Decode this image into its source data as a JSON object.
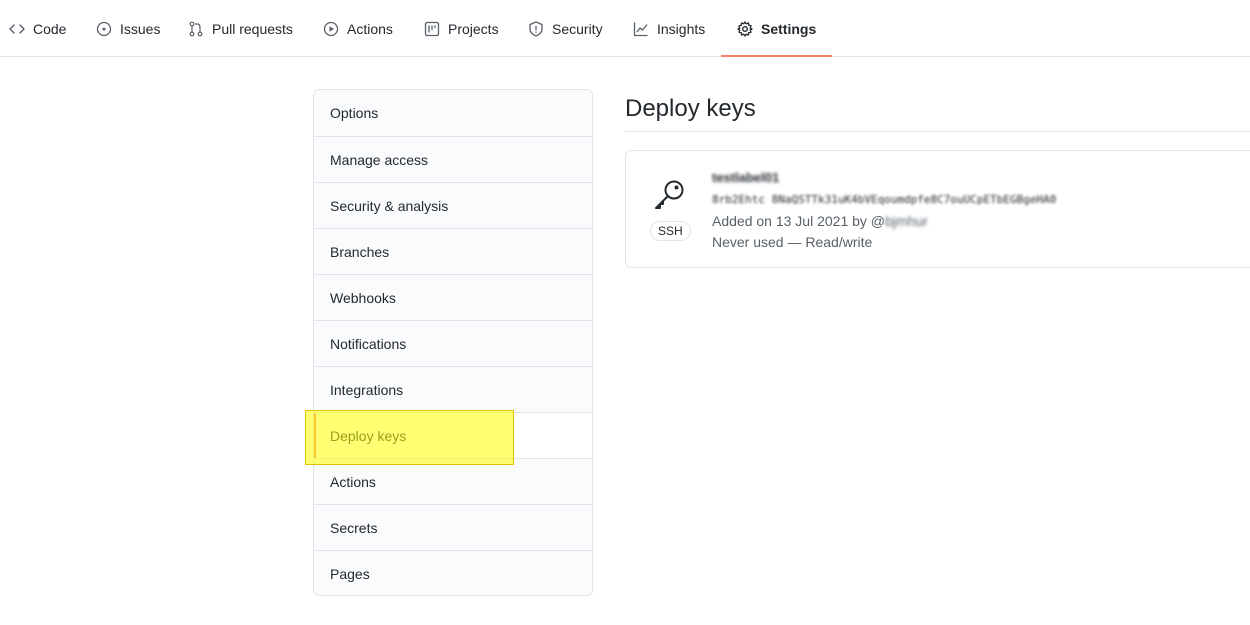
{
  "repo_nav": {
    "tabs": [
      {
        "label": "Code",
        "icon": "code-icon"
      },
      {
        "label": "Issues",
        "icon": "issue-opened-icon"
      },
      {
        "label": "Pull requests",
        "icon": "git-pull-request-icon"
      },
      {
        "label": "Actions",
        "icon": "play-icon"
      },
      {
        "label": "Projects",
        "icon": "project-icon"
      },
      {
        "label": "Security",
        "icon": "shield-icon"
      },
      {
        "label": "Insights",
        "icon": "graph-icon"
      },
      {
        "label": "Settings",
        "icon": "gear-icon",
        "selected": true
      }
    ]
  },
  "settings_menu": {
    "items": [
      {
        "label": "Options"
      },
      {
        "label": "Manage access"
      },
      {
        "label": "Security & analysis"
      },
      {
        "label": "Branches"
      },
      {
        "label": "Webhooks"
      },
      {
        "label": "Notifications"
      },
      {
        "label": "Integrations"
      },
      {
        "label": "Deploy keys",
        "selected": true
      },
      {
        "label": "Actions"
      },
      {
        "label": "Secrets"
      },
      {
        "label": "Pages"
      }
    ]
  },
  "main": {
    "title": "Deploy keys",
    "deploy_key": {
      "badge": "SSH",
      "title": "testlabel01",
      "fingerprint": "8rb2Ehtc 8NaQSTTk31uK4bVEqoumdpfe8C7ouUCpETbEGBgeHA0",
      "added_prefix": "Added on 13 Jul 2021 by @",
      "added_user": "bjmhur",
      "usage": "Never used — Read/write"
    }
  },
  "colors": {
    "accent": "#f9826c",
    "border": "#e1e4e8",
    "highlight": "#ffff00"
  }
}
